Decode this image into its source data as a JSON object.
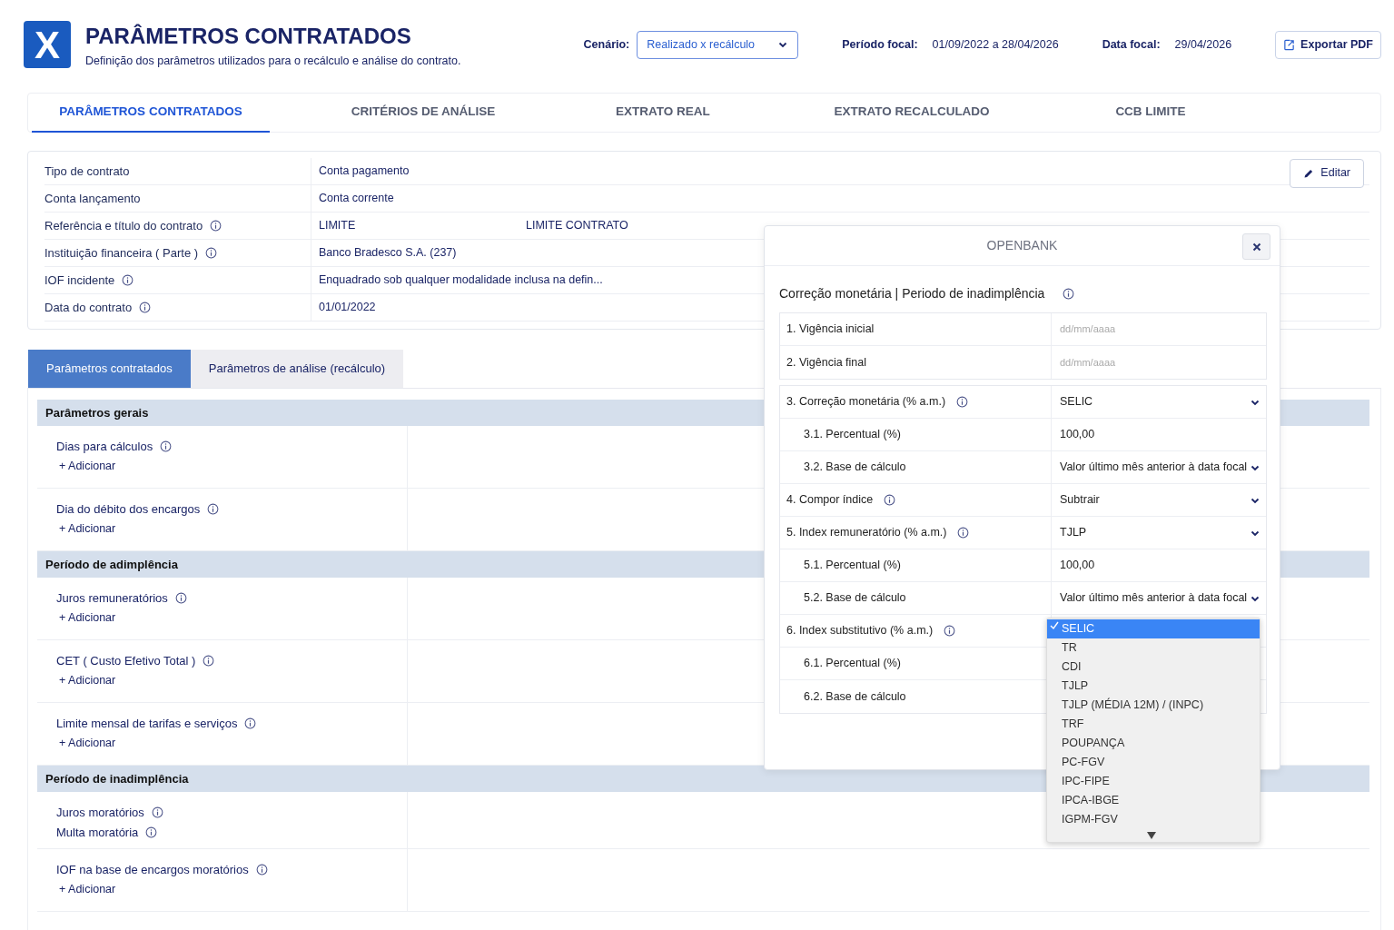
{
  "header": {
    "logo": "X",
    "title": "PARÂMETROS CONTRATADOS",
    "subtitle": "Definição dos parâmetros utilizados para o recálculo e análise do contrato.",
    "scenario_label": "Cenário:",
    "scenario_value": "Realizado x recálculo",
    "period_label": "Período focal:",
    "period_value": "01/09/2022 a 28/04/2026",
    "date_label": "Data focal:",
    "date_value": "29/04/2026",
    "export_button": "Exportar PDF"
  },
  "tabs": [
    {
      "label": "PARÂMETROS CONTRATADOS",
      "selected": true
    },
    {
      "label": "CRITÉRIOS DE ANÁLISE",
      "selected": false
    },
    {
      "label": "EXTRATO REAL",
      "selected": false
    },
    {
      "label": "EXTRATO RECALCULADO",
      "selected": false
    },
    {
      "label": "CCB LIMITE",
      "selected": false
    }
  ],
  "contract": {
    "edit_button": "Editar",
    "rows": [
      {
        "label": "Tipo de contrato",
        "info": false,
        "values": [
          "Conta pagamento"
        ]
      },
      {
        "label": "Conta lançamento",
        "info": false,
        "values": [
          "Conta corrente"
        ]
      },
      {
        "label": "Referência e título do contrato",
        "info": true,
        "values": [
          "LIMITE",
          "LIMITE CONTRATO"
        ]
      },
      {
        "label": "Instituição financeira ( Parte )",
        "info": true,
        "values": [
          "Banco Bradesco S.A. (237)"
        ]
      },
      {
        "label": "IOF incidente",
        "info": true,
        "values": [
          "Enquadrado sob qualquer modalidade inclusa na defin..."
        ]
      },
      {
        "label": "Data do contrato",
        "info": true,
        "values": [
          "01/01/2022"
        ]
      }
    ]
  },
  "sub_tabs": [
    {
      "label": "Parâmetros contratados",
      "selected": true
    },
    {
      "label": "Parâmetros de análise (recálculo)",
      "selected": false
    }
  ],
  "sections": [
    {
      "title": "Parâmetros gerais",
      "rows": [
        {
          "lines": [
            {
              "label": "Dias para cálculos",
              "info": true
            }
          ],
          "add": "+ Adicionar"
        },
        {
          "lines": [
            {
              "label": "Dia do débito dos encargos",
              "info": true
            }
          ],
          "add": "+ Adicionar"
        }
      ]
    },
    {
      "title": "Período de adimplência",
      "rows": [
        {
          "lines": [
            {
              "label": "Juros remuneratórios",
              "info": true
            }
          ],
          "add": "+ Adicionar"
        },
        {
          "lines": [
            {
              "label": "CET ( Custo Efetivo Total )",
              "info": true
            }
          ],
          "add": "+ Adicionar"
        },
        {
          "lines": [
            {
              "label": "Limite mensal de tarifas e serviços",
              "info": true
            }
          ],
          "add": "+ Adicionar"
        }
      ]
    },
    {
      "title": "Período de inadimplência",
      "rows": [
        {
          "lines": [
            {
              "label": "Juros moratórios",
              "info": true
            },
            {
              "label": "Multa moratória",
              "info": true
            }
          ]
        },
        {
          "lines": [
            {
              "label": "IOF na base de encargos moratórios",
              "info": true
            }
          ],
          "add": "+ Adicionar"
        }
      ]
    }
  ],
  "modal": {
    "title": "OPENBANK",
    "section_title": "Correção monetária | Periodo de inadimplência",
    "section_info": true,
    "groups": [
      [
        {
          "label": "1. Vigência inicial",
          "kind": "date",
          "placeholder": "dd/mm/aaaa"
        },
        {
          "label": "2. Vigência final",
          "kind": "date",
          "placeholder": "dd/mm/aaaa"
        }
      ],
      [
        {
          "label": "3. Correção monetária (% a.m.)",
          "info": true,
          "kind": "select",
          "value": "SELIC",
          "children": [
            {
              "label": "3.1. Percentual (%)",
              "kind": "text",
              "value": "100,00"
            },
            {
              "label": "3.2. Base de cálculo",
              "kind": "select",
              "value": "Valor último mês anterior à data focal"
            }
          ]
        },
        {
          "label": "4. Compor índice",
          "info": true,
          "kind": "select",
          "value": "Subtrair"
        },
        {
          "label": "5. Index remuneratório (% a.m.)",
          "info": true,
          "kind": "select",
          "value": "TJLP",
          "children": [
            {
              "label": "5.1. Percentual (%)",
              "kind": "text",
              "value": "100,00"
            },
            {
              "label": "5.2. Base de cálculo",
              "kind": "select",
              "value": "Valor último mês anterior à data focal"
            }
          ]
        },
        {
          "label": "6. Index substitutivo (% a.m.)",
          "info": true,
          "kind": "open",
          "children": [
            {
              "label": "6.1. Percentual (%)",
              "kind": "hidden"
            },
            {
              "label": "6.2. Base de cálculo",
              "kind": "hidden"
            }
          ]
        }
      ]
    ],
    "dropdown": [
      {
        "label": "SELIC",
        "selected": true
      },
      {
        "label": "TR",
        "selected": false
      },
      {
        "label": "CDI",
        "selected": false
      },
      {
        "label": "TJLP",
        "selected": false
      },
      {
        "label": "TJLP (MÉDIA 12M) / (INPC)",
        "selected": false
      },
      {
        "label": "TRF",
        "selected": false
      },
      {
        "label": "POUPANÇA",
        "selected": false
      },
      {
        "label": "PC-FGV",
        "selected": false
      },
      {
        "label": "IPC-FIPE",
        "selected": false
      },
      {
        "label": "IPCA-IBGE",
        "selected": false
      },
      {
        "label": "IGPM-FGV",
        "selected": false
      }
    ]
  }
}
